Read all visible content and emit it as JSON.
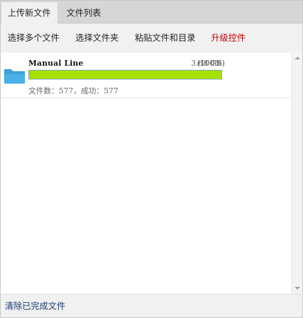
{
  "tabs": [
    {
      "label": "上传新文件",
      "active": true
    },
    {
      "label": "文件列表",
      "active": false
    }
  ],
  "toolbar": {
    "select_files": "选择多个文件",
    "select_folder": "选择文件夹",
    "paste": "粘贴文件和目录",
    "upgrade": "升级控件",
    "upgrade_color": "#c0000a"
  },
  "files": [
    {
      "name": "Manual Line",
      "size": "3.68 GB",
      "percent_label": "(100%)",
      "progress": 1.0,
      "stats": "文件数：577，成功：577",
      "icon": "folder-icon",
      "progress_color": "#a6e000"
    }
  ],
  "footer": {
    "clear_completed": "清除已完成文件"
  }
}
